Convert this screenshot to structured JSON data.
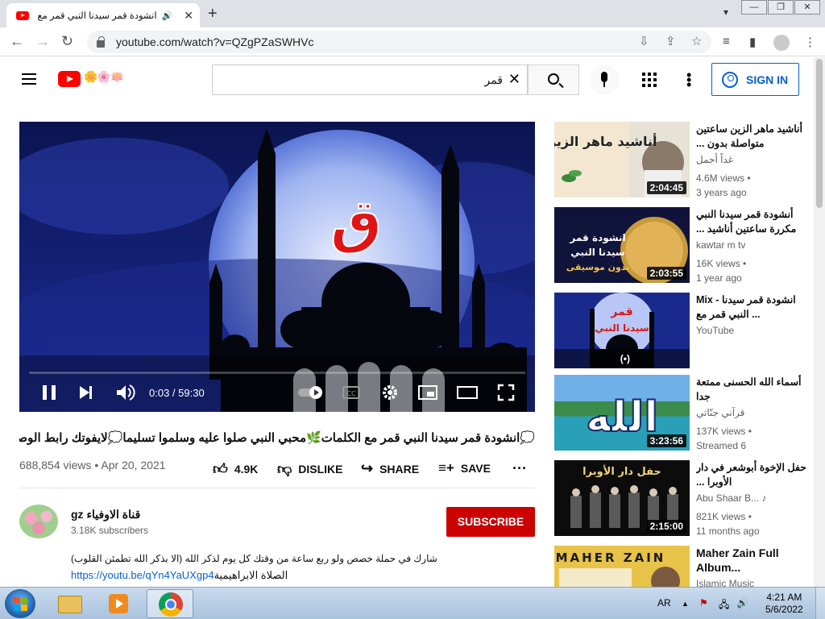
{
  "browser": {
    "tab_title": "انشودة قمر سيدنا النبي قمر مع الكلمات",
    "new_tab": "+",
    "tab_close": "✕",
    "url": "youtube.com/watch?v=QZgPZaSWHVc",
    "window_controls": [
      "—",
      "❐",
      "✕"
    ]
  },
  "masthead": {
    "search_query": "قمر",
    "sign_in": "SIGN IN",
    "logo_doodle": "🌼🌸🪷",
    "icons": [
      "menu-icon",
      "search-icon",
      "mic-icon",
      "apps-icon",
      "more-icon"
    ]
  },
  "player": {
    "time": "0:03 / 59:30",
    "progress_fraction": 0.0008,
    "big_letter": "ق",
    "colors": {
      "accent": "#ff0000",
      "sky": "#1a2a8c"
    }
  },
  "video": {
    "title": "💭انشودة قمر سيدنا النبي قمر مع الكلمات🌿محبي النبي صلوا عليه وسلموا تسليما💭لايفوتك رابط الوصف",
    "views_date": "688,854 views • Apr 20, 2021",
    "likes": "4.9K",
    "dislike": "DISLIKE",
    "share": "SHARE",
    "save": "SAVE"
  },
  "channel": {
    "name": "gz قناة الاوفياء",
    "subs": "3.18K subscribers",
    "subscribe": "SUBSCRIBE",
    "desc_line1": "شارك في حملة خصص ولو ربع ساعة من وقتك كل يوم لذكر الله (الا بذكر الله تطمئن القلوب)",
    "desc_link": "https://youtu.be/qYn4YaUXgp4",
    "desc_link_suffix": "الصلاة الابراهيمية"
  },
  "sidebar": [
    {
      "title": "أناشيد ماهر الزين ساعتين متواصلة بدون ...",
      "channel": "غداً أجمل",
      "meta1": "4.6M views •",
      "meta2": "3 years ago",
      "duration": "2:04:45",
      "thumb_text": "أناشيد ماهر الزين"
    },
    {
      "title": "أنشودة قمر سيدنا النبي مكررة ساعتين أناشيد ...",
      "channel": "kawtar m tv",
      "meta1": "16K views •",
      "meta2": "1 year ago",
      "duration": "2:03:55",
      "thumb_text": "انشودة قمر سيدنا النبي بدون موسيقى"
    },
    {
      "title": "Mix - انشودة قمر سيدنا النبي قمر مع ...",
      "channel": "YouTube",
      "meta1": "",
      "meta2": "",
      "duration": "(•)",
      "thumb_text": "قمر سيدنا النبي"
    },
    {
      "title": "أسماء الله الحسنى ممتعة جدا",
      "channel": "قرآني جنّاتي",
      "meta1": "137K views •",
      "meta2": "Streamed 6",
      "duration": "3:23:56",
      "thumb_text": "الله"
    },
    {
      "title": "حفل الإخوة أبوشعر في دار الأوبرا ...",
      "channel": "Abu Shaar B...",
      "meta1": "821K views •",
      "meta2": "11 months ago",
      "duration": "2:15:00",
      "thumb_text": "حفل دار الأوبرا"
    },
    {
      "title": "Maher Zain Full Album...",
      "channel": "Islamic Music",
      "meta1": "",
      "meta2": "",
      "duration": "",
      "thumb_text": "MAHER ZAIN"
    }
  ],
  "taskbar": {
    "lang": "AR",
    "time": "4:21 AM",
    "date": "5/6/2022"
  }
}
